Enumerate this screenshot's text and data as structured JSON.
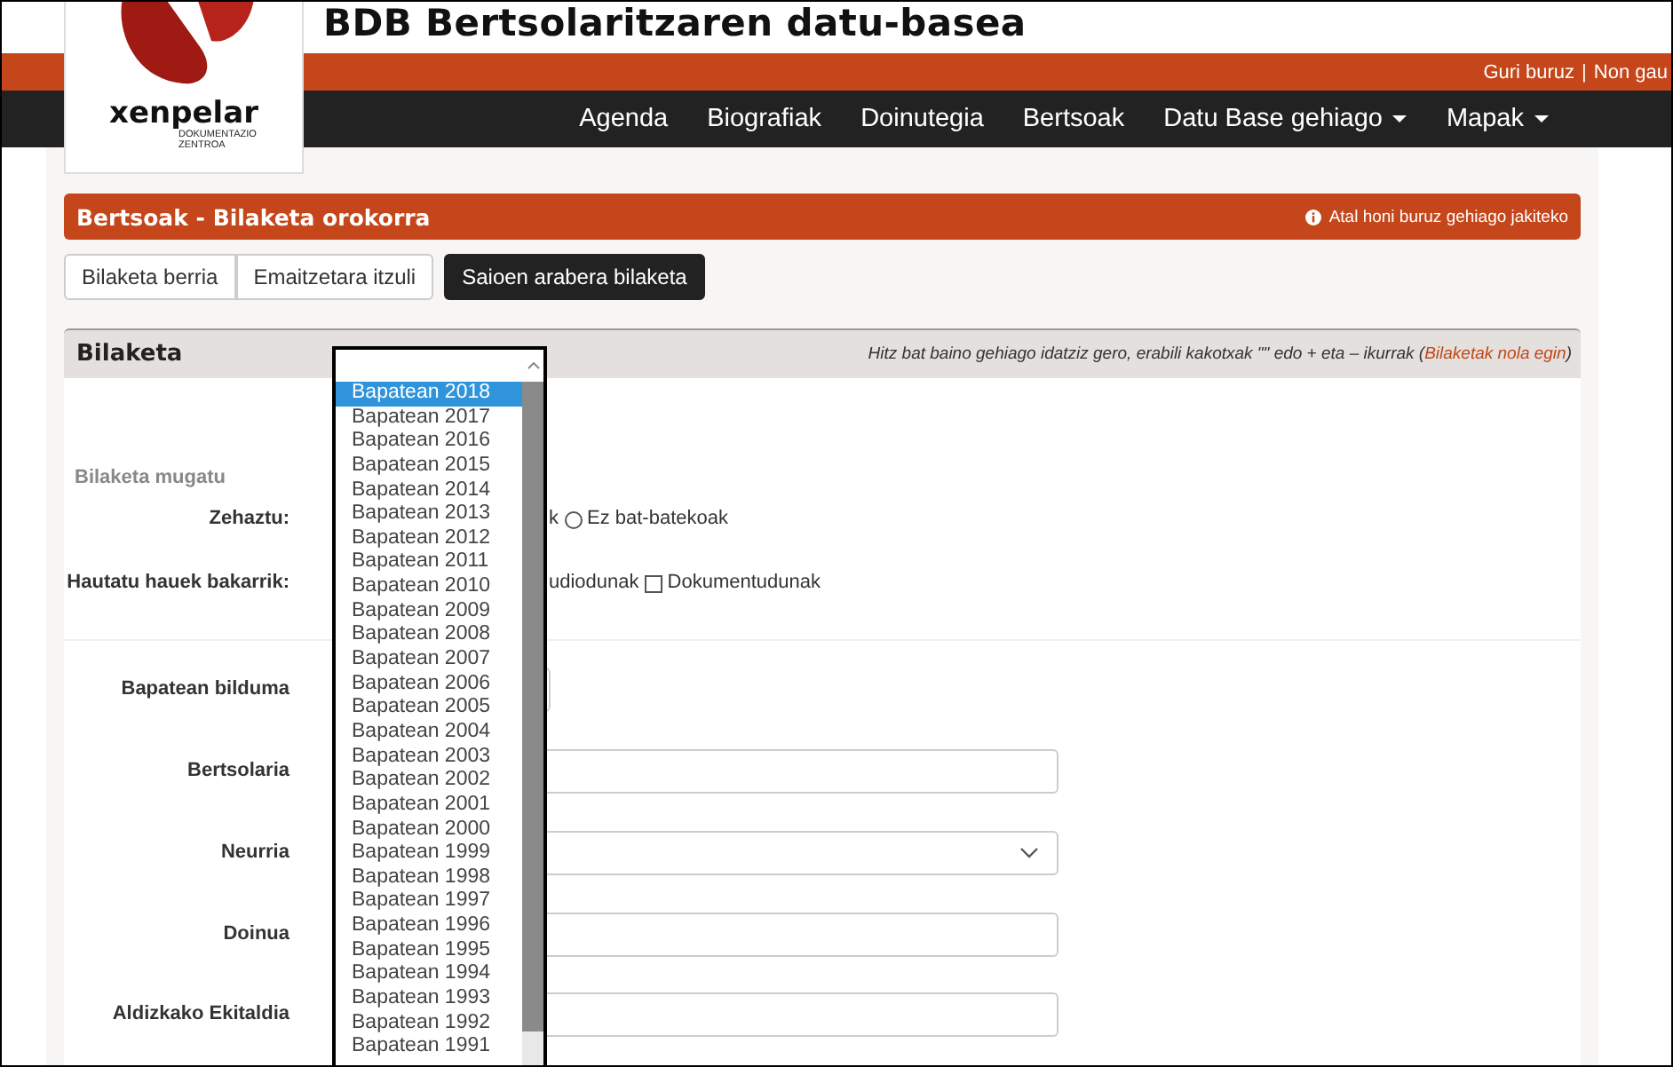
{
  "header": {
    "title": "BDB Bertsolaritzaren datu-basea",
    "logo": {
      "name": "xenpelar",
      "subtitle": "DOKUMENTAZIO ZENTROA"
    }
  },
  "top_links": {
    "items": [
      "Guri buruz",
      "Non gau"
    ],
    "separator": "|"
  },
  "nav": [
    {
      "label": "Agenda",
      "dropdown": false
    },
    {
      "label": "Biografiak",
      "dropdown": false
    },
    {
      "label": "Doinutegia",
      "dropdown": false
    },
    {
      "label": "Bertsoak",
      "dropdown": false
    },
    {
      "label": "Datu Base gehiago",
      "dropdown": true
    },
    {
      "label": "Mapak",
      "dropdown": true
    }
  ],
  "section": {
    "title": "Bertsoak - Bilaketa orokorra",
    "info_link": "Atal honi buruz gehiago jakiteko"
  },
  "actions": [
    {
      "label": "Bilaketa berria",
      "selected": false
    },
    {
      "label": "Emaitzetara itzuli",
      "selected": false
    },
    {
      "label": "Saioen arabera bilaketa",
      "selected": true
    }
  ],
  "search_panel": {
    "title": "Bilaketa",
    "hint": "Hitz bat baino gehiago idatziz gero, erabili kakotxak \"\" edo + eta – ikurrak (",
    "hint_link": "Bilaketak nola egin",
    "hint_end": ")"
  },
  "filters": {
    "title": "Bilaketa mugatu",
    "rows": [
      {
        "kind": "radio",
        "label": "Zehaztu:",
        "partial_text": "k",
        "options": [
          {
            "label": "Ez bat-batekoak",
            "checked": false
          }
        ]
      },
      {
        "kind": "checkbox",
        "label": "Hautatu hauek bakarrik:",
        "partial_text": "udiodunak",
        "options": [
          {
            "label": "Dokumentudunak",
            "checked": false
          }
        ]
      }
    ]
  },
  "fields": [
    {
      "label": "Bapatean bilduma",
      "kind": "open_select"
    },
    {
      "label": "Bertsolaria",
      "kind": "text"
    },
    {
      "label": "Neurria",
      "kind": "select"
    },
    {
      "label": "Doinua",
      "kind": "text"
    },
    {
      "label": "Aldizkako Ekitaldia",
      "kind": "text"
    }
  ],
  "dropdown": {
    "options": [
      {
        "label": "Bapatean 2018",
        "selected": true
      },
      {
        "label": "Bapatean 2017",
        "selected": false
      },
      {
        "label": "Bapatean 2016",
        "selected": false
      },
      {
        "label": "Bapatean 2015",
        "selected": false
      },
      {
        "label": "Bapatean 2014",
        "selected": false
      },
      {
        "label": "Bapatean 2013",
        "selected": false
      },
      {
        "label": "Bapatean 2012",
        "selected": false
      },
      {
        "label": "Bapatean 2011",
        "selected": false
      },
      {
        "label": "Bapatean 2010",
        "selected": false
      },
      {
        "label": "Bapatean 2009",
        "selected": false
      },
      {
        "label": "Bapatean 2008",
        "selected": false
      },
      {
        "label": "Bapatean 2007",
        "selected": false
      },
      {
        "label": "Bapatean 2006",
        "selected": false
      },
      {
        "label": "Bapatean 2005",
        "selected": false
      },
      {
        "label": "Bapatean 2004",
        "selected": false
      },
      {
        "label": "Bapatean 2003",
        "selected": false
      },
      {
        "label": "Bapatean 2002",
        "selected": false
      },
      {
        "label": "Bapatean 2001",
        "selected": false
      },
      {
        "label": "Bapatean 2000",
        "selected": false
      },
      {
        "label": "Bapatean 1999",
        "selected": false
      },
      {
        "label": "Bapatean 1998",
        "selected": false
      },
      {
        "label": "Bapatean 1997",
        "selected": false
      },
      {
        "label": "Bapatean 1996",
        "selected": false
      },
      {
        "label": "Bapatean 1995",
        "selected": false
      },
      {
        "label": "Bapatean 1994",
        "selected": false
      },
      {
        "label": "Bapatean 1993",
        "selected": false
      },
      {
        "label": "Bapatean 1992",
        "selected": false
      },
      {
        "label": "Bapatean 1991",
        "selected": false
      }
    ]
  }
}
